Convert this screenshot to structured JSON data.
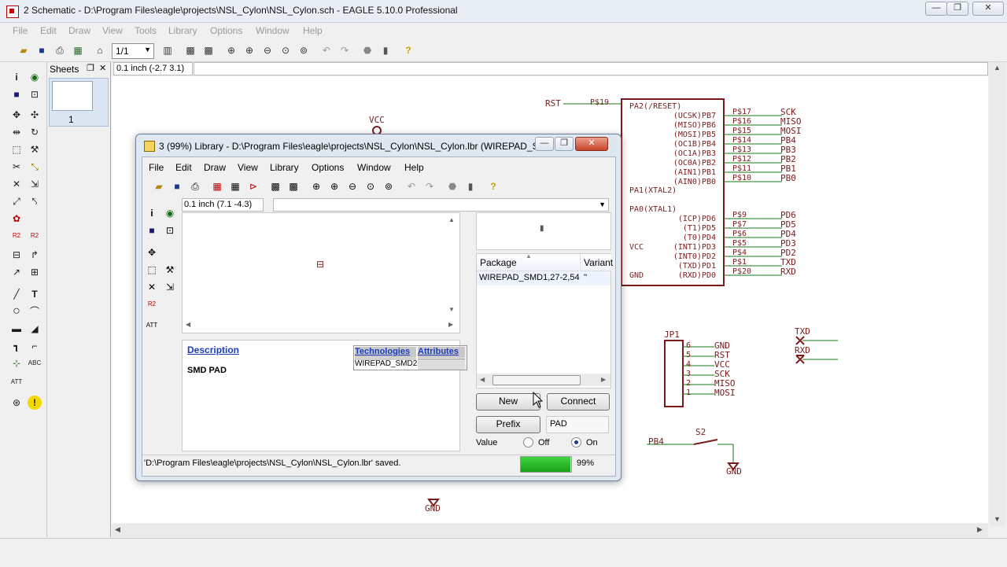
{
  "window": {
    "title": "2 Schematic - D:\\Program Files\\eagle\\projects\\NSL_Cylon\\NSL_Cylon.sch - EAGLE 5.10.0 Professional",
    "minimize": "—",
    "maximize": "❐",
    "close": "✕"
  },
  "menu": [
    "File",
    "Edit",
    "Draw",
    "View",
    "Tools",
    "Library",
    "Options",
    "Window",
    "Help"
  ],
  "toolbar": {
    "sheet_select": "1/1"
  },
  "sheets": {
    "title": "Sheets",
    "sheet_number": "1"
  },
  "coords": "0.1 inch (-2.7 3.1)",
  "schematic": {
    "vcc_label": "VCC",
    "gnd_label": "GND",
    "rst_net": "RST",
    "p19": "P$19",
    "ic_pins_left_top": [
      "PA2(/RESET)"
    ],
    "ic_pins_right_b": [
      "(UCSK)PB7",
      "(MISO)PB6",
      "(MOSI)PB5",
      "(OC1B)PB4",
      "(OC1A)PB3",
      "(OC0A)PB2",
      "(AIN1)PB1",
      "(AIN0)PB0"
    ],
    "pb_pads": [
      "P$17",
      "P$16",
      "P$15",
      "P$14",
      "P$13",
      "P$12",
      "P$11",
      "P$10"
    ],
    "pb_nets": [
      "SCK",
      "MISO",
      "MOSI",
      "PB4",
      "PB3",
      "PB2",
      "PB1",
      "PB0"
    ],
    "xtal2": "PA1(XTAL2)",
    "xtal1": "PA0(XTAL1)",
    "ic_pins_right_d": [
      "(ICP)PD6",
      "(T1)PD5",
      "(T0)PD4",
      "(INT1)PD3",
      "(INT0)PD2",
      "(TXD)PD1",
      "(RXD)PD0"
    ],
    "pd_pads": [
      "P$9",
      "P$7",
      "P$6",
      "P$5",
      "P$4",
      "P$1",
      "P$20"
    ],
    "pd_nets": [
      "PD6",
      "PD5",
      "PD4",
      "PD3",
      "PD2",
      "TXD",
      "RXD"
    ],
    "ic_vcc": "VCC",
    "ic_gnd": "GND",
    "jp1": "JP1",
    "jp1_nums": [
      "6",
      "5",
      "4",
      "3",
      "2",
      "1"
    ],
    "jp1_nets": [
      "GND",
      "RST",
      "VCC",
      "SCK",
      "MISO",
      "MOSI"
    ],
    "txd": "TXD",
    "rxd": "RXD",
    "s2": "S2",
    "pb4": "PB4",
    "gnd2": "GND",
    "gnd3": "GND"
  },
  "library": {
    "title": "3 (99%) Library - D:\\Program Files\\eagle\\projects\\NSL_Cylon\\NSL_Cylon.lbr (WIREPAD_S...",
    "menu": [
      "File",
      "Edit",
      "Draw",
      "View",
      "Library",
      "Options",
      "Window",
      "Help"
    ],
    "coords": "0.1 inch (7.1 -4.3)",
    "command": "",
    "package_col": "Package",
    "variant_col": "Variant",
    "package_row": "WIREPAD_SMD1,27-2,54",
    "variant_row": "''",
    "description_link": "Description",
    "description_text": "SMD PAD",
    "technologies": "Technologies",
    "attributes": "Attributes",
    "tech_value": "WIREPAD_SMD2",
    "new_btn": "New",
    "connect_btn": "Connect",
    "prefix_btn": "Prefix",
    "prefix_value": "PAD",
    "value_label": "Value",
    "off_label": "Off",
    "on_label": "On",
    "status": "'D:\\Program Files\\eagle\\projects\\NSL_Cylon\\NSL_Cylon.lbr' saved.",
    "progress_text": "99%",
    "progress": 0.99
  }
}
